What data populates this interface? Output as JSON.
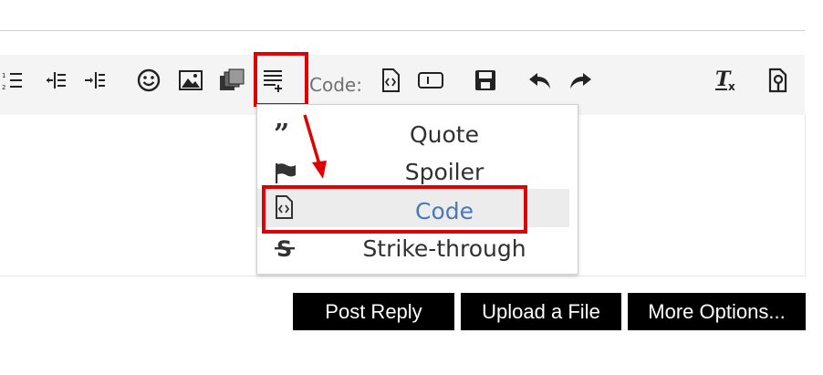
{
  "toolbar": {
    "code_label": "Code:",
    "icons": [
      "ordered-list-icon",
      "outdent-icon",
      "indent-icon",
      "smiley-icon",
      "image-icon",
      "media-icon",
      "insert-block-icon",
      "code-block-icon",
      "inline-code-icon",
      "save-icon",
      "undo-icon",
      "redo-icon",
      "remove-format-icon",
      "toggle-bbcode-icon"
    ]
  },
  "dropdown": {
    "items": [
      {
        "label": "Quote",
        "icon": "quote-icon"
      },
      {
        "label": "Spoiler",
        "icon": "flag-icon"
      },
      {
        "label": "Code",
        "icon": "code-file-icon",
        "active": true
      },
      {
        "label": "Strike-through",
        "icon": "strikethrough-icon"
      }
    ]
  },
  "actions": {
    "post_reply": "Post Reply",
    "upload_file": "Upload a File",
    "more_options": "More Options..."
  },
  "colors": {
    "highlight": "#e00000",
    "active_text": "#4a78b8",
    "toolbar_bg": "#f4f4f4",
    "button_bg": "#000000"
  }
}
